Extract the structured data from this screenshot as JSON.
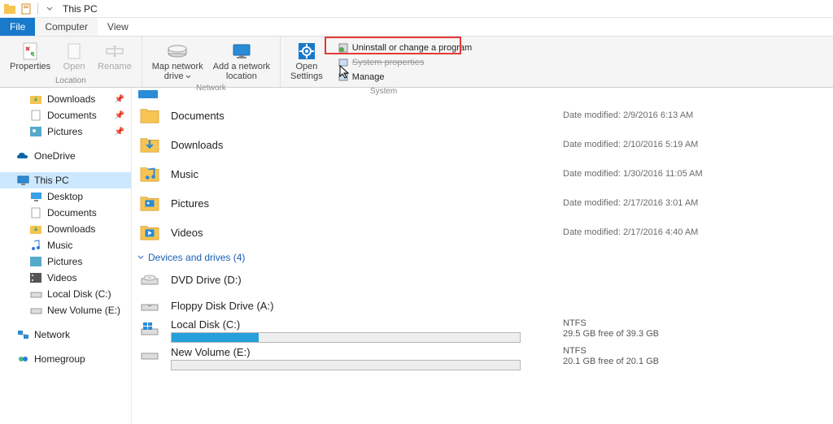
{
  "titlebar": {
    "title": "This PC"
  },
  "tabs": {
    "file": "File",
    "computer": "Computer",
    "view": "View"
  },
  "ribbon": {
    "location": {
      "label": "Location",
      "properties": "Properties",
      "open": "Open",
      "rename": "Rename"
    },
    "network": {
      "label": "Network",
      "map_drive_l1": "Map network",
      "map_drive_l2": "drive",
      "add_loc_l1": "Add a network",
      "add_loc_l2": "location"
    },
    "system": {
      "label": "System",
      "open_settings_l1": "Open",
      "open_settings_l2": "Settings",
      "uninstall": "Uninstall or change a program",
      "sysprops": "System properties",
      "manage": "Manage"
    }
  },
  "nav": {
    "downloads": "Downloads",
    "documents": "Documents",
    "pictures": "Pictures",
    "onedrive": "OneDrive",
    "thispc": "This PC",
    "desktop": "Desktop",
    "documents2": "Documents",
    "downloads2": "Downloads",
    "music": "Music",
    "pictures2": "Pictures",
    "videos": "Videos",
    "localdisk": "Local Disk (C:)",
    "newvol": "New Volume (E:)",
    "network": "Network",
    "homegroup": "Homegroup"
  },
  "content": {
    "date_label": "Date modified:",
    "folders": [
      {
        "name": "Documents",
        "date": "2/9/2016 6:13 AM",
        "accent": "none"
      },
      {
        "name": "Downloads",
        "date": "2/10/2016 5:19 AM",
        "accent": "down"
      },
      {
        "name": "Music",
        "date": "1/30/2016 11:05 AM",
        "accent": "music"
      },
      {
        "name": "Pictures",
        "date": "2/17/2016 3:01 AM",
        "accent": "pic"
      },
      {
        "name": "Videos",
        "date": "2/17/2016 4:40 AM",
        "accent": "vid"
      }
    ],
    "devices_header": "Devices and drives (4)",
    "drives_simple": [
      {
        "name": "DVD Drive (D:)"
      },
      {
        "name": "Floppy Disk Drive (A:)"
      }
    ],
    "drives_storage": [
      {
        "name": "Local Disk (C:)",
        "fs": "NTFS",
        "free": "29.5 GB free of 39.3 GB",
        "fill_pct": 25
      },
      {
        "name": "New Volume (E:)",
        "fs": "NTFS",
        "free": "20.1 GB free of 20.1 GB",
        "fill_pct": 0
      }
    ]
  }
}
